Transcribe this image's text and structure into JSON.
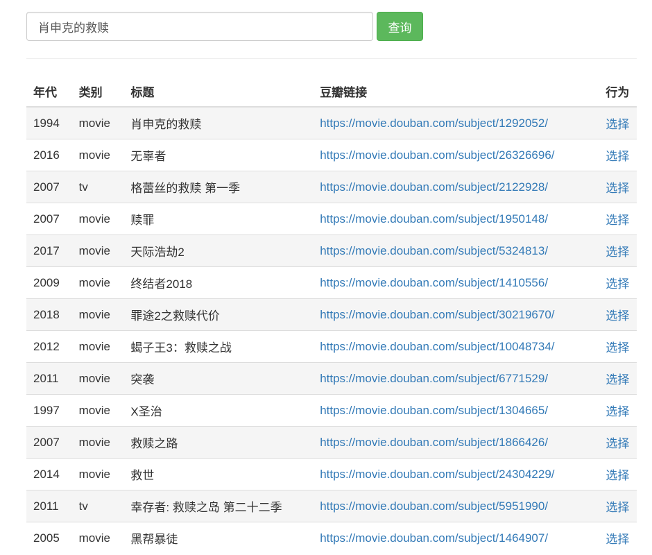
{
  "search": {
    "value": "肖申克的救赎",
    "button_label": "查询"
  },
  "table": {
    "headers": {
      "year": "年代",
      "type": "类别",
      "title": "标题",
      "link": "豆瓣链接",
      "action": "行为"
    },
    "rows": [
      {
        "year": "1994",
        "type": "movie",
        "title": "肖申克的救赎",
        "link": "https://movie.douban.com/subject/1292052/",
        "action": "选择"
      },
      {
        "year": "2016",
        "type": "movie",
        "title": "无辜者",
        "link": "https://movie.douban.com/subject/26326696/",
        "action": "选择"
      },
      {
        "year": "2007",
        "type": "tv",
        "title": "格蕾丝的救赎 第一季",
        "link": "https://movie.douban.com/subject/2122928/",
        "action": "选择"
      },
      {
        "year": "2007",
        "type": "movie",
        "title": "赎罪",
        "link": "https://movie.douban.com/subject/1950148/",
        "action": "选择"
      },
      {
        "year": "2017",
        "type": "movie",
        "title": "天际浩劫2",
        "link": "https://movie.douban.com/subject/5324813/",
        "action": "选择"
      },
      {
        "year": "2009",
        "type": "movie",
        "title": "终结者2018",
        "link": "https://movie.douban.com/subject/1410556/",
        "action": "选择"
      },
      {
        "year": "2018",
        "type": "movie",
        "title": "罪途2之救赎代价",
        "link": "https://movie.douban.com/subject/30219670/",
        "action": "选择"
      },
      {
        "year": "2012",
        "type": "movie",
        "title": "蝎子王3：救赎之战",
        "link": "https://movie.douban.com/subject/10048734/",
        "action": "选择"
      },
      {
        "year": "2011",
        "type": "movie",
        "title": "突袭",
        "link": "https://movie.douban.com/subject/6771529/",
        "action": "选择"
      },
      {
        "year": "1997",
        "type": "movie",
        "title": "X圣治",
        "link": "https://movie.douban.com/subject/1304665/",
        "action": "选择"
      },
      {
        "year": "2007",
        "type": "movie",
        "title": "救赎之路",
        "link": "https://movie.douban.com/subject/1866426/",
        "action": "选择"
      },
      {
        "year": "2014",
        "type": "movie",
        "title": "救世",
        "link": "https://movie.douban.com/subject/24304229/",
        "action": "选择"
      },
      {
        "year": "2011",
        "type": "tv",
        "title": "幸存者: 救赎之岛 第二十二季",
        "link": "https://movie.douban.com/subject/5951990/",
        "action": "选择"
      },
      {
        "year": "2005",
        "type": "movie",
        "title": "黑帮暴徒",
        "link": "https://movie.douban.com/subject/1464907/",
        "action": "选择"
      }
    ]
  },
  "colors": {
    "button_green": "#5cb85c",
    "link_blue": "#337ab7",
    "stripe_gray": "#f5f5f5"
  }
}
